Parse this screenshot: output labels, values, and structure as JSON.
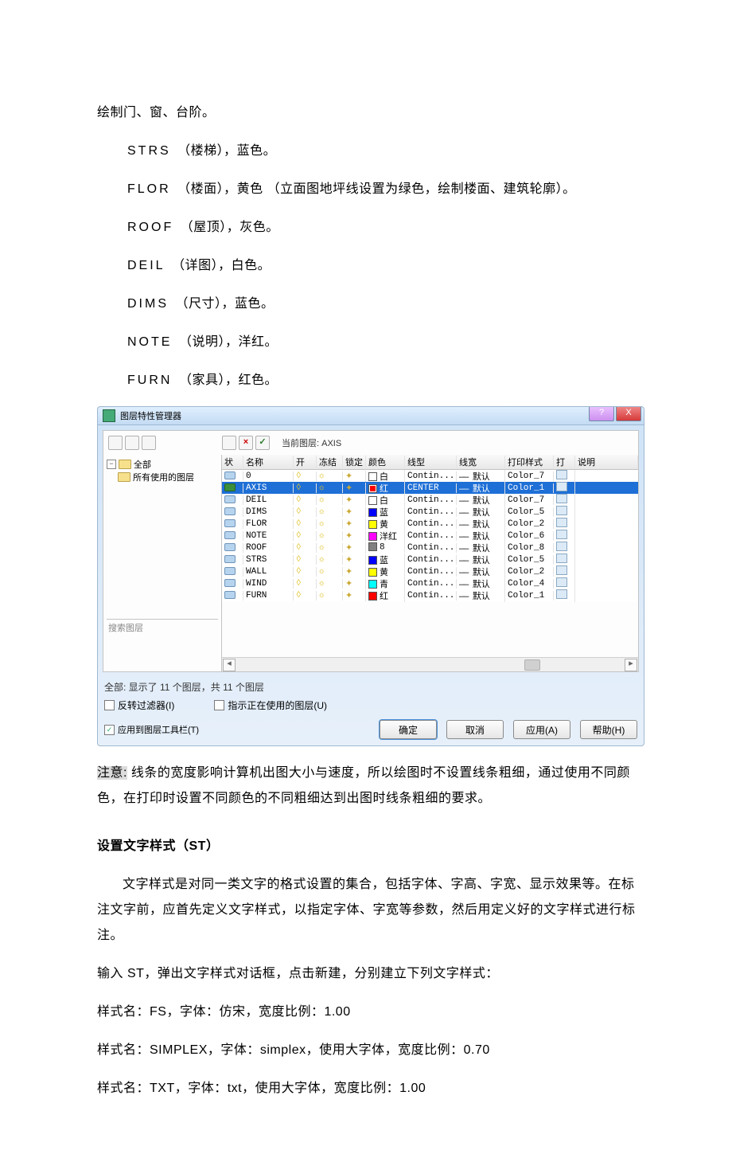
{
  "doc": {
    "line1": "绘制门、窗、台阶。",
    "layer_lines": [
      {
        "code": "STRS",
        "desc": "（楼梯），蓝色。"
      },
      {
        "code": "FLOR",
        "desc": "（楼面），黄色 （立面图地坪线设置为绿色，绘制楼面、建筑轮廓）。"
      },
      {
        "code": "ROOF",
        "desc": "（屋顶），灰色。"
      },
      {
        "code": "DEIL",
        "desc": "（详图），白色。"
      },
      {
        "code": "DIMS",
        "desc": "（尺寸），蓝色。"
      },
      {
        "code": "NOTE",
        "desc": "（说明），洋红。"
      },
      {
        "code": "FURN",
        "desc": "（家具），红色。"
      }
    ],
    "note_label": "注意:",
    "note_rest": "线条的宽度影响计算机出图大小与速度，所以绘图时不设置线条粗细，通过使用不同颜色，在打印时设置不同颜色的不同粗细达到出图时线条粗细的要求。",
    "h2": "设置文字样式（ST）",
    "p2": "文字样式是对同一类文字的格式设置的集合，包括字体、字高、字宽、显示效果等。在标注文字前，应首先定义文字样式，以指定字体、字宽等参数，然后用定义好的文字样式进行标注。",
    "p3": "输入 ST，弹出文字样式对话框，点击新建，分别建立下列文字样式：",
    "style_lines": [
      "样式名：FS，字体：仿宋，宽度比例：1.00",
      "样式名：SIMPLEX，字体：simplex，使用大字体，宽度比例：0.70",
      "样式名：TXT，字体：txt，使用大字体，宽度比例：1.00"
    ]
  },
  "dialog": {
    "title": "图层特性管理器",
    "help": "?",
    "close": "X",
    "current_label": "当前图层:",
    "current_value": "AXIS",
    "tree": {
      "root": "全部",
      "child": "所有使用的图层"
    },
    "search_placeholder": "搜索图层",
    "columns": [
      "状",
      "名称",
      "开",
      "冻结",
      "锁定",
      "颜色",
      "线型",
      "线宽",
      "打印样式",
      "打",
      "说明"
    ],
    "rows": [
      {
        "name": "0",
        "current": false,
        "on": "◊",
        "frz": "☼",
        "lock": "✦",
        "color": "白",
        "swatch": "#ffffff",
        "ltype": "Contin...",
        "lwt": "默认",
        "pstyle": "Color_7"
      },
      {
        "name": "AXIS",
        "current": true,
        "selected": true,
        "on": "◊",
        "frz": "☼",
        "lock": "✦",
        "color": "红",
        "swatch": "#ff0000",
        "ltype": "CENTER",
        "lwt": "默认",
        "pstyle": "Color_1"
      },
      {
        "name": "DEIL",
        "current": false,
        "on": "◊",
        "frz": "☼",
        "lock": "✦",
        "color": "白",
        "swatch": "#ffffff",
        "ltype": "Contin...",
        "lwt": "默认",
        "pstyle": "Color_7"
      },
      {
        "name": "DIMS",
        "current": false,
        "on": "◊",
        "frz": "☼",
        "lock": "✦",
        "color": "蓝",
        "swatch": "#0000ff",
        "ltype": "Contin...",
        "lwt": "默认",
        "pstyle": "Color_5"
      },
      {
        "name": "FLOR",
        "current": false,
        "on": "◊",
        "frz": "☼",
        "lock": "✦",
        "color": "黄",
        "swatch": "#ffff00",
        "ltype": "Contin...",
        "lwt": "默认",
        "pstyle": "Color_2"
      },
      {
        "name": "NOTE",
        "current": false,
        "on": "◊",
        "frz": "☼",
        "lock": "✦",
        "color": "洋红",
        "swatch": "#ff00ff",
        "ltype": "Contin...",
        "lwt": "默认",
        "pstyle": "Color_6"
      },
      {
        "name": "ROOF",
        "current": false,
        "on": "◊",
        "frz": "☼",
        "lock": "✦",
        "color": "8",
        "swatch": "#808080",
        "ltype": "Contin...",
        "lwt": "默认",
        "pstyle": "Color_8"
      },
      {
        "name": "STRS",
        "current": false,
        "on": "◊",
        "frz": "☼",
        "lock": "✦",
        "color": "蓝",
        "swatch": "#0000ff",
        "ltype": "Contin...",
        "lwt": "默认",
        "pstyle": "Color_5"
      },
      {
        "name": "WALL",
        "current": false,
        "on": "◊",
        "frz": "☼",
        "lock": "✦",
        "color": "黄",
        "swatch": "#ffff00",
        "ltype": "Contin...",
        "lwt": "默认",
        "pstyle": "Color_2"
      },
      {
        "name": "WIND",
        "current": false,
        "on": "◊",
        "frz": "☼",
        "lock": "✦",
        "color": "青",
        "swatch": "#00ffff",
        "ltype": "Contin...",
        "lwt": "默认",
        "pstyle": "Color_4"
      },
      {
        "name": "FURN",
        "current": false,
        "on": "◊",
        "frz": "☼",
        "lock": "✦",
        "color": "红",
        "swatch": "#ff0000",
        "ltype": "Contin...",
        "lwt": "默认",
        "pstyle": "Color_1"
      }
    ],
    "status": "全部: 显示了 11 个图层，共 11 个图层",
    "cb_invert": "反转过滤器(I)",
    "cb_inuse": "指示正在使用的图层(U)",
    "cb_toolbar": "应用到图层工具栏(T)",
    "btn_ok": "确定",
    "btn_cancel": "取消",
    "btn_apply": "应用(A)",
    "btn_help": "帮助(H)"
  }
}
